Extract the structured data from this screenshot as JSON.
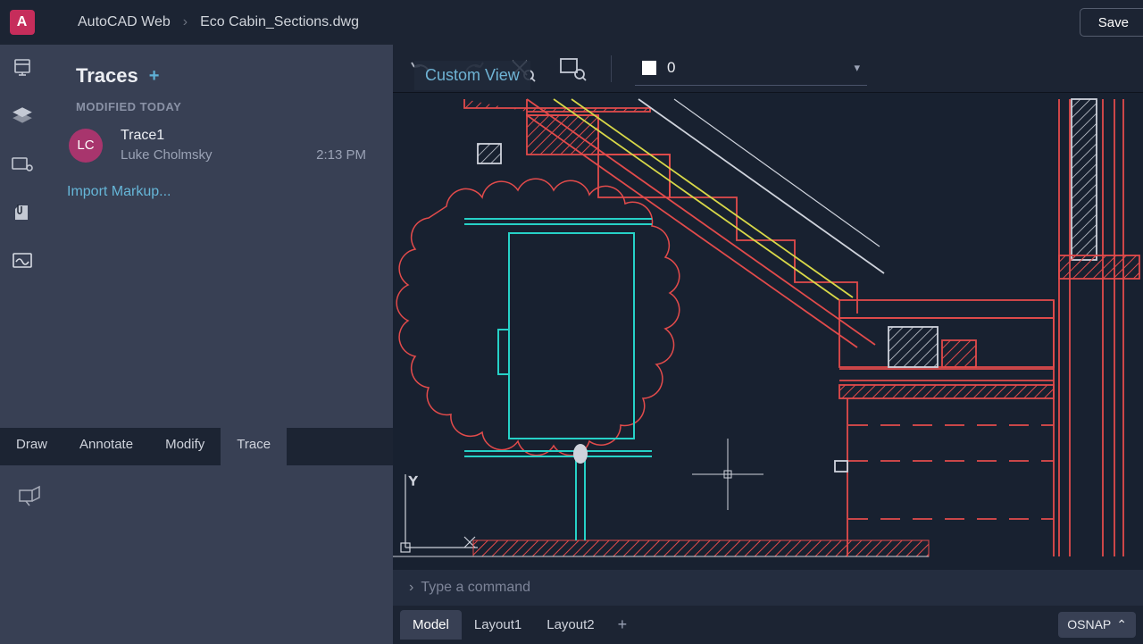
{
  "header": {
    "app_name": "AutoCAD Web",
    "file_name": "Eco Cabin_Sections.dwg",
    "save_label": "Save",
    "logo_letter": "A"
  },
  "sidebar": {
    "panel_title": "Traces",
    "section_label": "MODIFIED TODAY",
    "trace": {
      "initials": "LC",
      "name": "Trace1",
      "author": "Luke Cholmsky",
      "time": "2:13 PM"
    },
    "import_label": "Import Markup..."
  },
  "tool_tabs": [
    "Draw",
    "Annotate",
    "Modify",
    "Trace"
  ],
  "tool_tabs_active": 3,
  "canvas": {
    "view_label": "Custom View",
    "layer_value": "0",
    "command_placeholder": "Type a command"
  },
  "bottom_tabs": [
    "Model",
    "Layout1",
    "Layout2"
  ],
  "bottom_tabs_active": 0,
  "status": {
    "osnap_label": "OSNAP"
  }
}
